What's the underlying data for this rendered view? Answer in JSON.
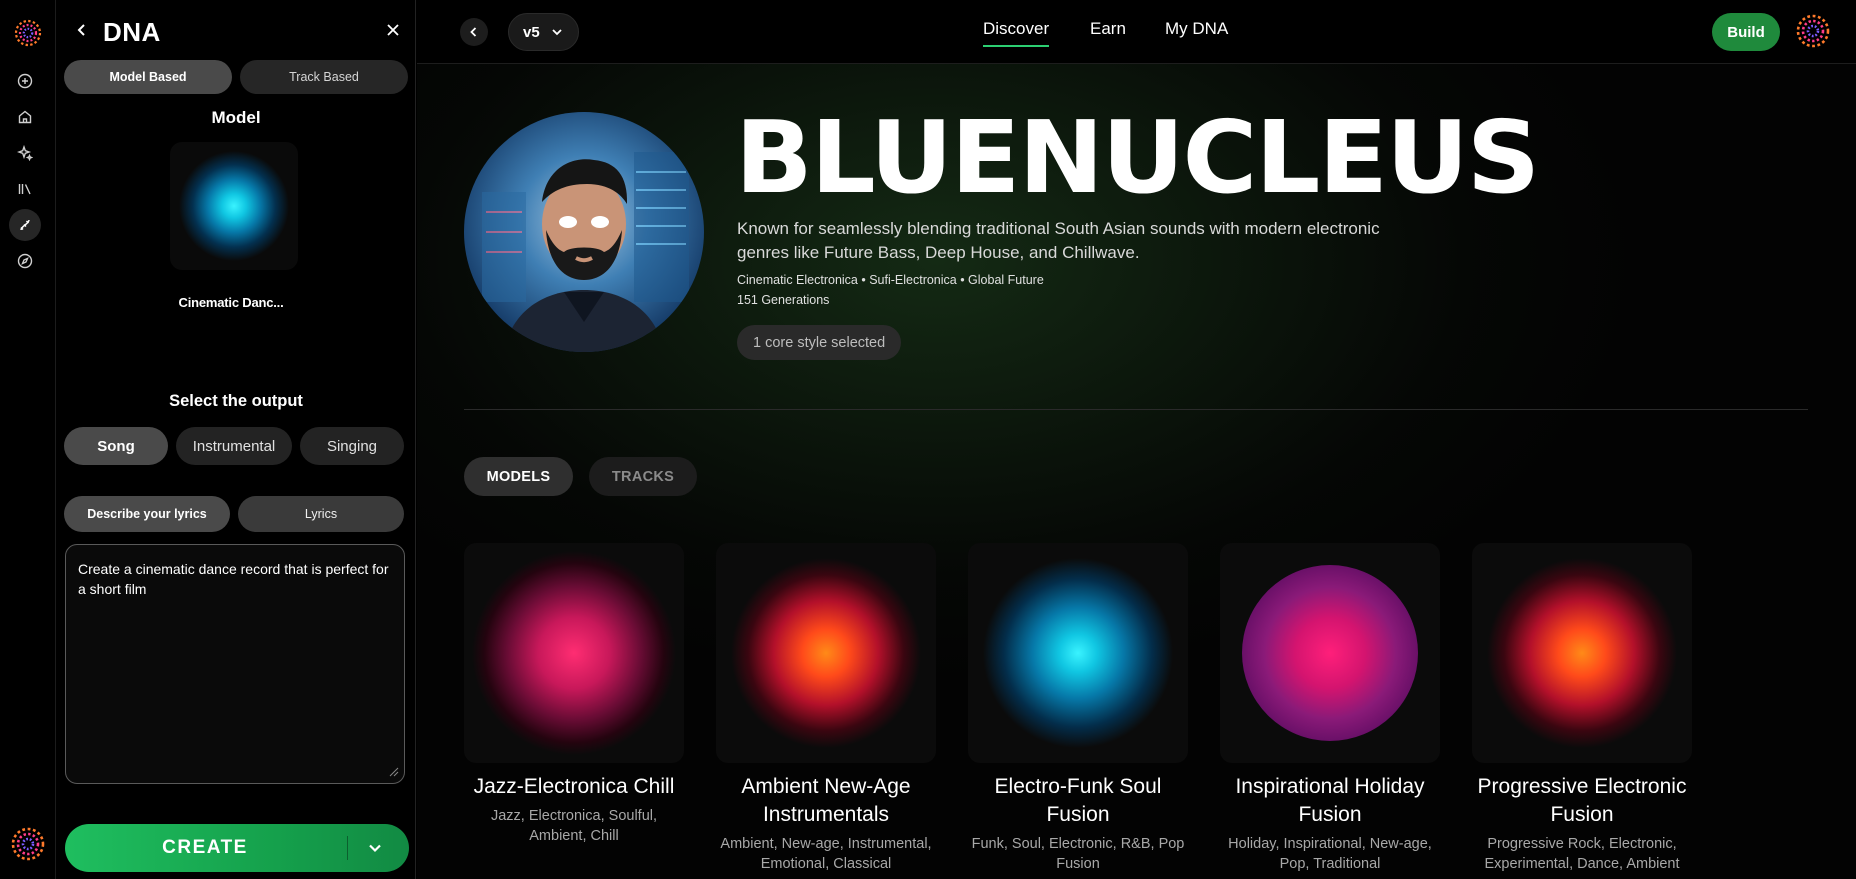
{
  "panel": {
    "title": "DNA",
    "segments": [
      {
        "label": "Model Based"
      },
      {
        "label": "Track Based"
      }
    ],
    "model_label": "Model",
    "model_name": "Cinematic Danc...",
    "select_label": "Select the output",
    "outputs": [
      {
        "label": "Song"
      },
      {
        "label": "Instrumental"
      },
      {
        "label": "Singing"
      }
    ],
    "lyric_tabs": [
      {
        "label": "Describe your lyrics"
      },
      {
        "label": "Lyrics"
      }
    ],
    "prompt_value": "Create a cinematic dance record that is perfect for a short film",
    "create_label": "CREATE"
  },
  "topbar": {
    "version": "v5",
    "tabs": [
      {
        "label": "Discover"
      },
      {
        "label": "Earn"
      },
      {
        "label": "My DNA"
      }
    ],
    "build_label": "Build"
  },
  "artist": {
    "name": "BLUENUCLEUS",
    "bio": "Known for seamlessly blending traditional South Asian sounds with modern electronic genres like Future Bass, Deep House, and Chillwave.",
    "genres": "Cinematic Electronica • Sufi-Electronica • Global Future",
    "generations": "151 Generations",
    "core_style": "1 core style selected"
  },
  "content_tabs": [
    {
      "label": "MODELS"
    },
    {
      "label": "TRACKS"
    }
  ],
  "models": [
    {
      "title": "Jazz-Electronica Chill",
      "tags": "Jazz, Electronica, Soulful, Ambient, Chill"
    },
    {
      "title": "Ambient New-Age Instrumentals",
      "tags": "Ambient, New-age, Instrumental, Emotional, Classical"
    },
    {
      "title": "Electro-Funk Soul Fusion",
      "tags": "Funk, Soul, Electronic, R&B, Pop Fusion"
    },
    {
      "title": "Inspirational Holiday Fusion",
      "tags": "Holiday, Inspirational, New-age, Pop, Traditional"
    },
    {
      "title": "Progressive Electronic Fusion",
      "tags": "Progressive Rock, Electronic, Experimental, Dance, Ambient"
    }
  ],
  "icons": {
    "rail": [
      "logo-icon",
      "add-circle-icon",
      "home-icon",
      "sparkle-icon",
      "library-icon",
      "dna-icon",
      "compass-icon"
    ],
    "accent": "#1fbe5f"
  }
}
